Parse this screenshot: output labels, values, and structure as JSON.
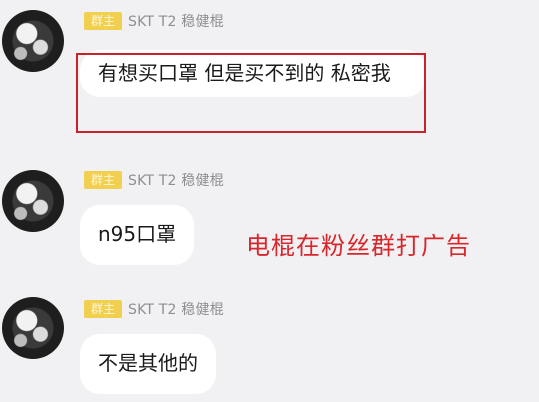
{
  "messages": [
    {
      "badge": "群主",
      "sender": "SKT T2 稳健棍",
      "text": "有想买口罩 但是买不到的 私密我"
    },
    {
      "badge": "群主",
      "sender": "SKT T2 稳健棍",
      "text": "n95口罩"
    },
    {
      "badge": "群主",
      "sender": "SKT T2 稳健棍",
      "text": "不是其他的"
    }
  ],
  "annotation": "电棍在粉丝群打广告",
  "colors": {
    "annotation": "#d8262b",
    "highlight_box": "#c8232c",
    "badge": "#f1cf4f",
    "background": "#f1f1f3",
    "bubble": "#ffffff"
  }
}
